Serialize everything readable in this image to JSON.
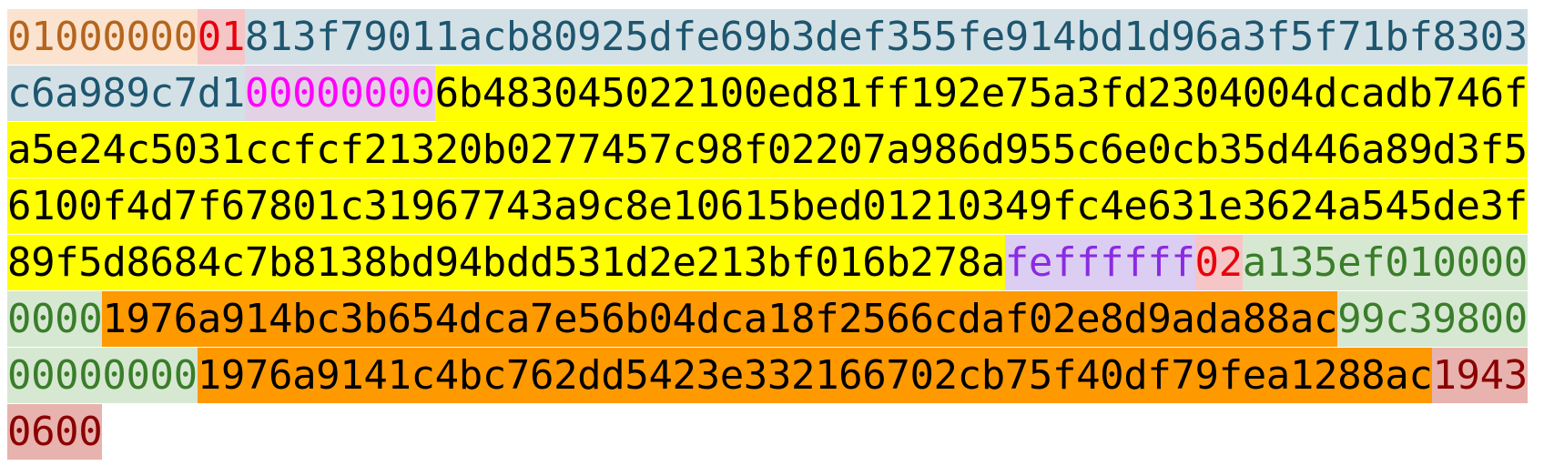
{
  "transaction_hex": {
    "version": "01000000",
    "input_count": "01",
    "input_txid": "813f79011acb80925dfe69b3def355fe914bd1d96a3f5f71bf8303c6a989c7d1",
    "input_vout": "00000000",
    "input_scriptsig": "6b483045022100ed81ff192e75a3fd2304004dcadb746fa5e24c5031ccfcf21320b0277457c98f02207a986d955c6e0cb35d446a89d3f56100f4d7f67801c31967743a9c8e10615bed01210349fc4e631e3624a545de3f89f5d8684c7b8138bd94bdd531d2e213bf016b278a",
    "input_sequence": "feffffff",
    "output_count": "02",
    "output_1_value": "a135ef0100000000",
    "output_1_scriptpubkey": "1976a914bc3b654dca7e56b04dca18f2566cdaf02e8d9ada88ac",
    "output_2_value": "99c3980000000000",
    "output_2_scriptpubkey": "1976a9141c4bc762dd5423e332166702cb75f40df79fea1288ac",
    "locktime": "19430600"
  },
  "colors": {
    "version": "#b5651d",
    "count": "#e8000c",
    "txid": "#1e5670",
    "vout": "#ff00ff",
    "scriptsig_bg": "#ffff00",
    "sequence": "#8a2be2",
    "value": "#3a7d2a",
    "scriptpubkey_bg": "#ff9900",
    "locktime": "#8b0000"
  }
}
